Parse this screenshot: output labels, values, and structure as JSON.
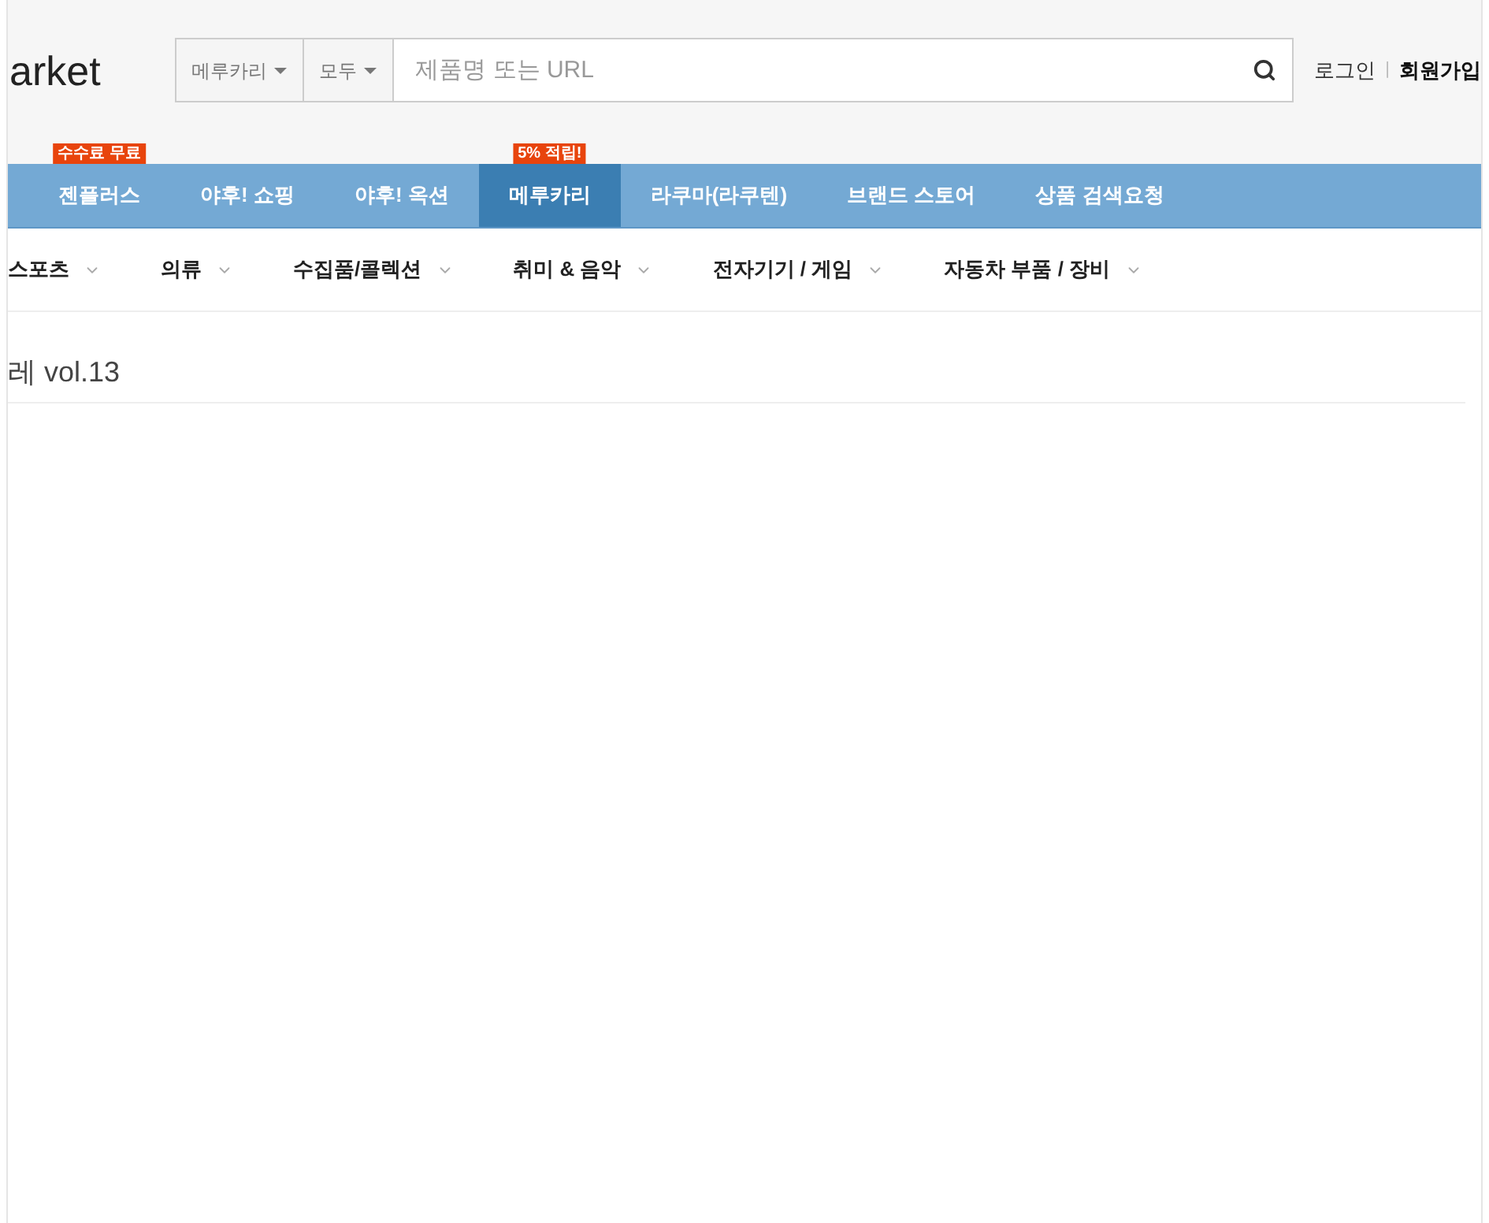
{
  "logo": "arket",
  "search": {
    "site": "메루카리",
    "scope": "모두",
    "placeholder": "제품명 또는 URL"
  },
  "account": {
    "login": "로그인",
    "separator": "|",
    "signup": "회원가입"
  },
  "nav": [
    {
      "label": "젠플러스",
      "badge": "수수료 무료",
      "selected": false
    },
    {
      "label": "야후! 쇼핑",
      "selected": false
    },
    {
      "label": "야후! 옥션",
      "selected": false
    },
    {
      "label": "메루카리",
      "badge": "5% 적립!",
      "selected": true
    },
    {
      "label": "라쿠마(라쿠텐)",
      "selected": false
    },
    {
      "label": "브랜드 스토어",
      "selected": false
    },
    {
      "label": "상품 검색요청",
      "selected": false
    }
  ],
  "categories": [
    "스포츠",
    "의류",
    "수집품/콜렉션",
    "취미 & 음악",
    "전자기기 / 게임",
    "자동차 부품 / 장비"
  ],
  "page_title": "레 vol.13"
}
